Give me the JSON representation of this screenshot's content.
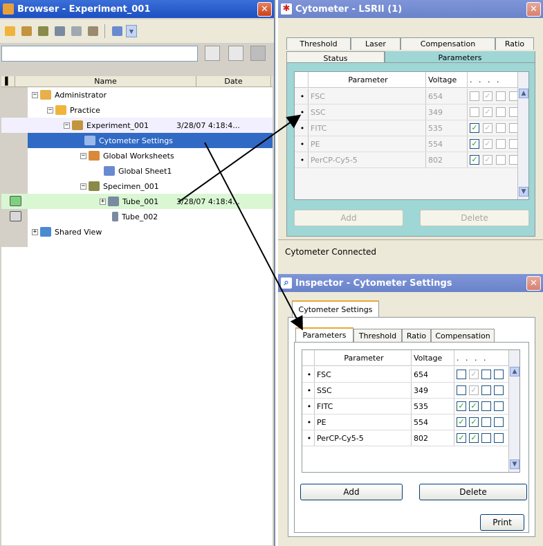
{
  "browser": {
    "title": "Browser - Experiment_001",
    "close": "✕",
    "columns": {
      "name": "Name",
      "date": "Date"
    },
    "tree": [
      {
        "label": "Administrator",
        "date": ""
      },
      {
        "label": "Practice",
        "date": ""
      },
      {
        "label": "Experiment_001",
        "date": "3/28/07 4:18:4..."
      },
      {
        "label": "Cytometer Settings",
        "date": ""
      },
      {
        "label": "Global Worksheets",
        "date": ""
      },
      {
        "label": "Global Sheet1",
        "date": ""
      },
      {
        "label": "Specimen_001",
        "date": ""
      },
      {
        "label": "Tube_001",
        "date": "3/28/07 4:18:4..."
      },
      {
        "label": "Tube_002",
        "date": ""
      },
      {
        "label": "Shared View",
        "date": ""
      }
    ]
  },
  "cytometer": {
    "title": "Cytometer - LSRII (1)",
    "close": "✕",
    "tabs_back": [
      "Threshold",
      "Laser",
      "Compensation",
      "Ratio"
    ],
    "tabs_front": [
      "Status",
      "Parameters"
    ],
    "columns": {
      "parameter": "Parameter",
      "voltage": "Voltage",
      "flags": ". . . ."
    },
    "rows": [
      {
        "param": "FSC",
        "voltage": "654",
        "checks": [
          false,
          true,
          false,
          false
        ]
      },
      {
        "param": "SSC",
        "voltage": "349",
        "checks": [
          false,
          true,
          false,
          false
        ]
      },
      {
        "param": "FITC",
        "voltage": "535",
        "checks": [
          true,
          true,
          false,
          false
        ]
      },
      {
        "param": "PE",
        "voltage": "554",
        "checks": [
          true,
          true,
          false,
          false
        ]
      },
      {
        "param": "PerCP-Cy5-5",
        "voltage": "802",
        "checks": [
          true,
          true,
          false,
          false
        ]
      }
    ],
    "add": "Add",
    "delete": "Delete",
    "status": "Cytometer Connected"
  },
  "inspector": {
    "title": "Inspector - Cytometer Settings",
    "close": "✕",
    "outer_tab": "Cytometer Settings",
    "tabs": [
      "Parameters",
      "Threshold",
      "Ratio",
      "Compensation"
    ],
    "columns": {
      "parameter": "Parameter",
      "voltage": "Voltage",
      "flags": ". . . ."
    },
    "rows": [
      {
        "param": "FSC",
        "voltage": "654",
        "checks": [
          false,
          true,
          false,
          false
        ]
      },
      {
        "param": "SSC",
        "voltage": "349",
        "checks": [
          false,
          true,
          false,
          false
        ]
      },
      {
        "param": "FITC",
        "voltage": "535",
        "checks": [
          true,
          true,
          false,
          false
        ]
      },
      {
        "param": "PE",
        "voltage": "554",
        "checks": [
          true,
          true,
          false,
          false
        ]
      },
      {
        "param": "PerCP-Cy5-5",
        "voltage": "802",
        "checks": [
          true,
          true,
          false,
          false
        ]
      }
    ],
    "add": "Add",
    "delete": "Delete",
    "print": "Print"
  },
  "colors": {
    "selection": "#316ac5",
    "highlight_row": "#d9f7d3",
    "check": "#21a121",
    "tab_accent": "#e9a83a"
  }
}
